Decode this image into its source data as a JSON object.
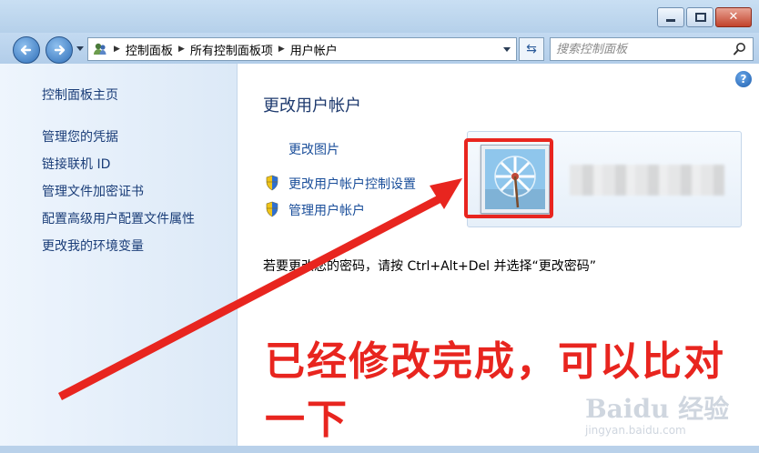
{
  "window": {
    "close_label": "✕"
  },
  "toolbar": {
    "crumbs": [
      "控制面板",
      "所有控制面板项",
      "用户帐户"
    ],
    "search_placeholder": "搜索控制面板"
  },
  "sidebar": {
    "items": [
      {
        "label": "控制面板主页"
      },
      {
        "label": "管理您的凭据"
      },
      {
        "label": "链接联机 ID"
      },
      {
        "label": "管理文件加密证书"
      },
      {
        "label": "配置高级用户配置文件属性"
      },
      {
        "label": "更改我的环境变量"
      }
    ]
  },
  "main": {
    "title": "更改用户帐户",
    "links": {
      "change_picture": "更改图片",
      "uac_settings": "更改用户帐户控制设置",
      "manage_accounts": "管理用户帐户"
    },
    "info_text": "若要更改您的密码，请按 Ctrl+Alt+Del 并选择“更改密码”"
  },
  "annotation": {
    "text": "已经修改完成，可以比对一下",
    "color": "#e8251f"
  },
  "watermark": {
    "logo": "Baidu 经验",
    "url": "jingyan.baidu.com"
  },
  "icons": {
    "back": "back-arrow-icon",
    "forward": "forward-arrow-icon",
    "refresh": "refresh-icon",
    "search": "search-icon",
    "help": "help-icon",
    "shield": "uac-shield-icon"
  }
}
